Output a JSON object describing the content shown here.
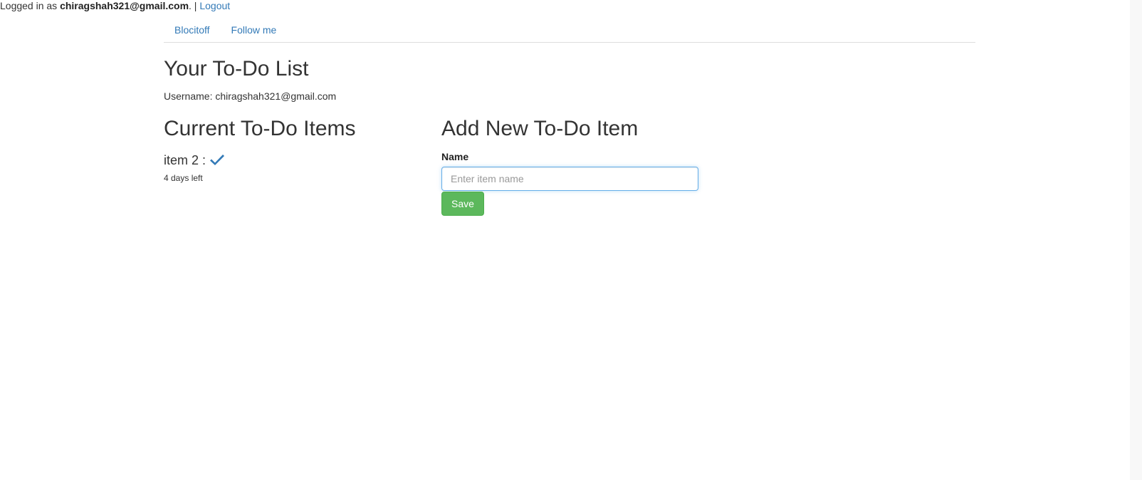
{
  "login_bar": {
    "prefix": "Logged in as ",
    "email": "chiragshah321@gmail.com",
    "separator": ". | ",
    "logout_label": "Logout"
  },
  "nav": {
    "items": [
      {
        "label": "Blocitoff"
      },
      {
        "label": "Follow me"
      }
    ]
  },
  "page": {
    "title": "Your To-Do List",
    "username_label": "Username: chiragshah321@gmail.com"
  },
  "todo_list": {
    "title": "Current To-Do Items",
    "items": [
      {
        "name": "item 2 :",
        "days_left": "4 days left",
        "icon": "check-icon"
      }
    ]
  },
  "new_item_form": {
    "title": "Add New To-Do Item",
    "name_label": "Name",
    "name_value": "",
    "name_placeholder": "Enter item name",
    "save_label": "Save"
  },
  "colors": {
    "link": "#337ab7",
    "save_button": "#5cb85c",
    "input_focus_border": "#66afe9",
    "text": "#333333"
  }
}
